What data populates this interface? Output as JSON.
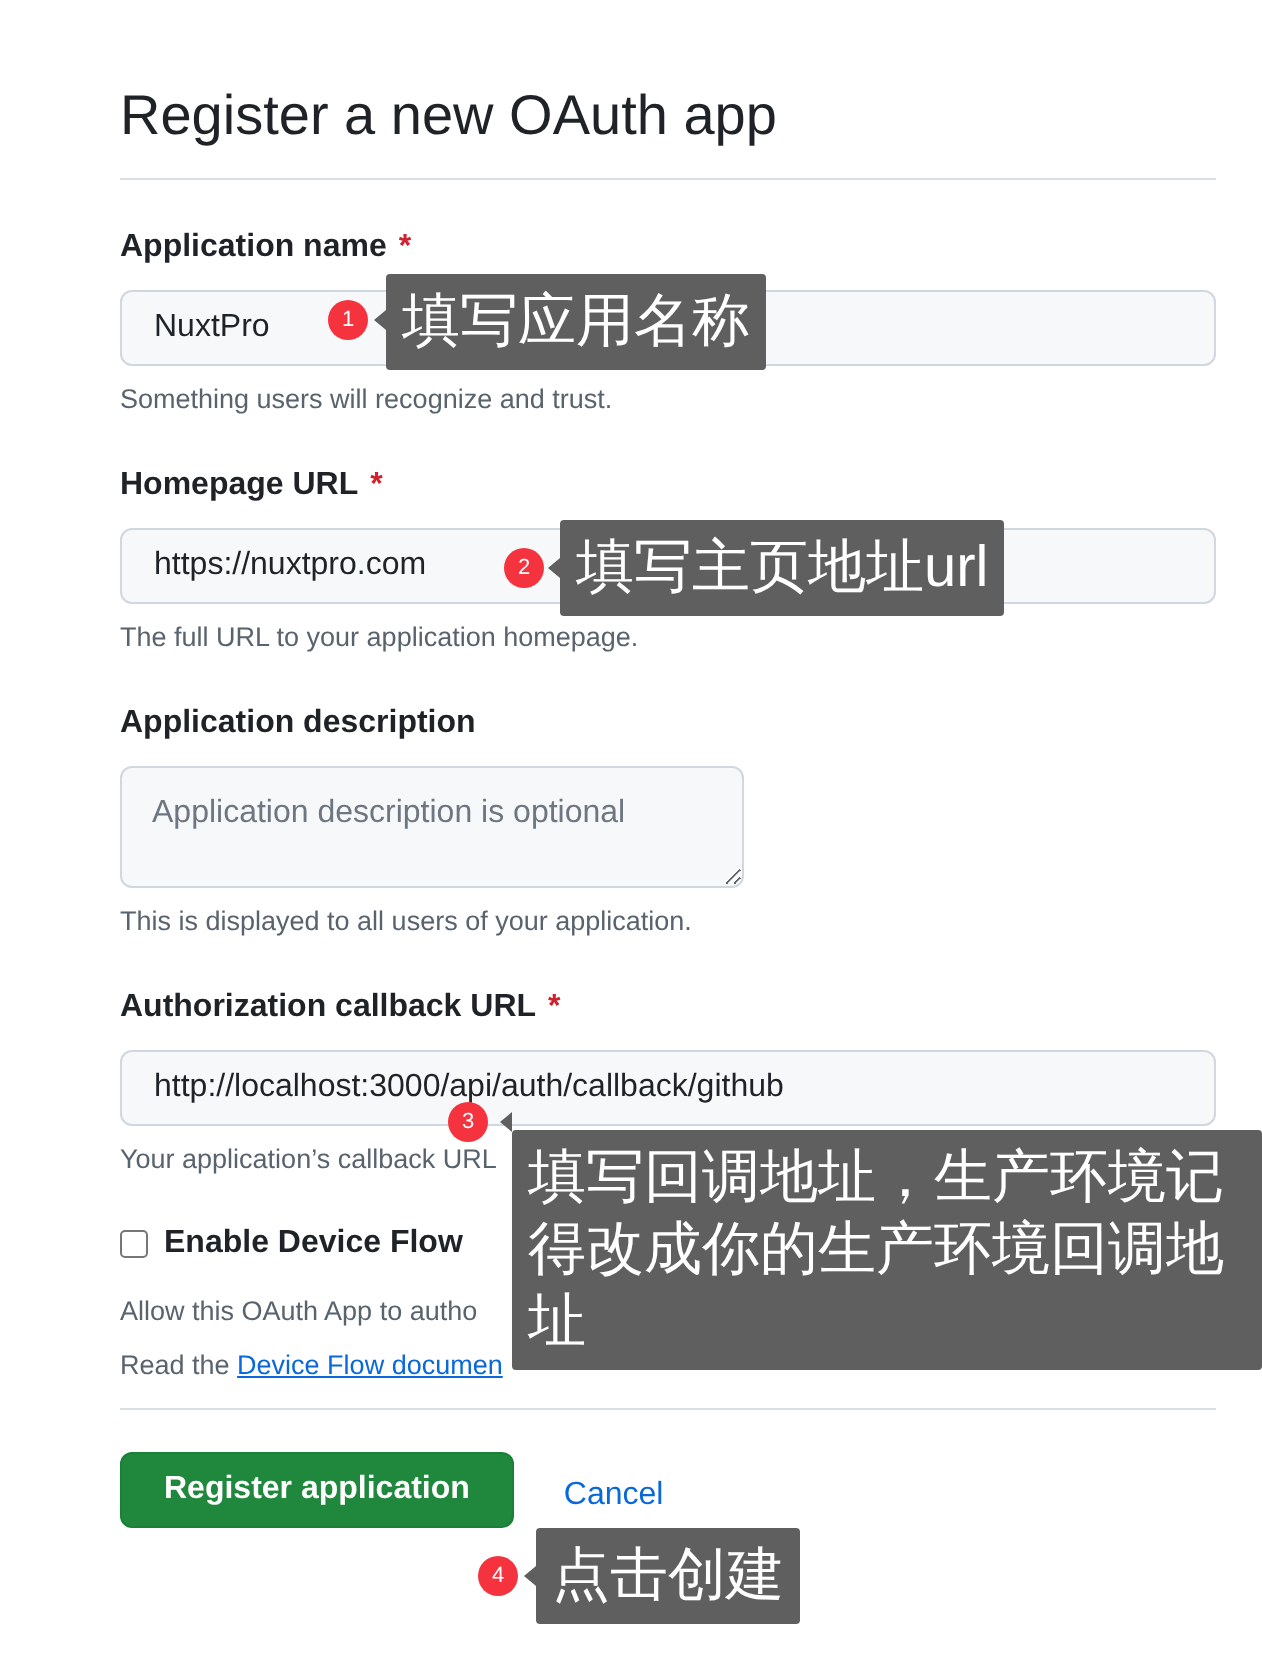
{
  "page": {
    "title": "Register a new OAuth app"
  },
  "fields": [
    {
      "kind": "input",
      "label": "Application name",
      "required_mark": "*",
      "value": "NuxtPro",
      "help": {
        "text": "Something users will recognize and trust."
      }
    },
    {
      "kind": "input",
      "label": "Homepage URL",
      "required_mark": "*",
      "value": "https://nuxtpro.com",
      "help": {
        "text": "The full URL to your application homepage."
      }
    },
    {
      "kind": "textarea",
      "label": "Application description",
      "placeholder": "Application description is optional",
      "help": {
        "text": "This is displayed to all users of your application."
      }
    },
    {
      "kind": "input",
      "label": "Authorization callback URL",
      "required_mark": "*",
      "value": "http://localhost:3000/api/auth/callback/github",
      "help": {
        "text": "Your application’s callback URL"
      }
    }
  ],
  "device_flow": {
    "label": "Enable Device Flow",
    "checked": false,
    "help": [
      {
        "text": "Allow this OAuth App to autho"
      },
      {
        "text": "Read the ",
        "link": "Device Flow documen"
      }
    ]
  },
  "actions": {
    "submit": "Register application",
    "cancel": "Cancel"
  },
  "annotations": [
    {
      "number": "1",
      "text": "填写应用名称"
    },
    {
      "number": "2",
      "text": "填写主页地址url"
    },
    {
      "number": "3",
      "text": "填写回调地址，生产环境记得改成你的生产环境回调地址"
    },
    {
      "number": "4",
      "text": "点击创建"
    }
  ]
}
